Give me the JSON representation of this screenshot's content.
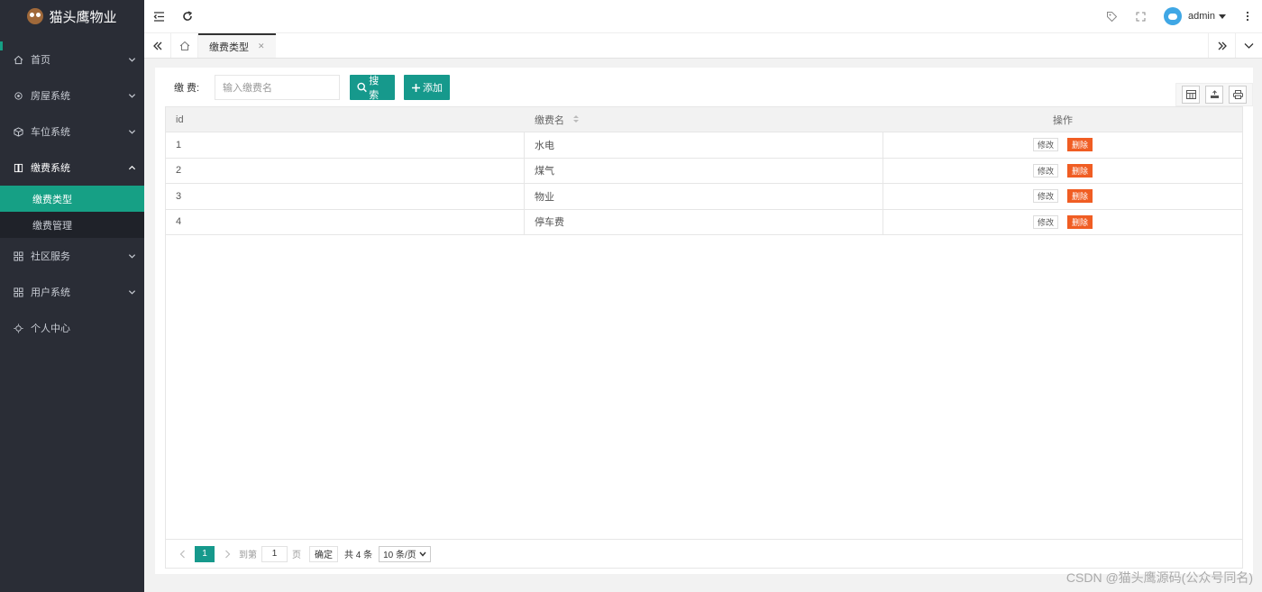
{
  "app": {
    "title": "猫头鹰物业"
  },
  "sidebar": {
    "items": [
      {
        "label": "首页",
        "icon": "home-icon",
        "has_children": true
      },
      {
        "label": "房屋系统",
        "icon": "settings-icon",
        "has_children": true
      },
      {
        "label": "车位系统",
        "icon": "cube-icon",
        "has_children": true
      },
      {
        "label": "缴费系统",
        "icon": "book-icon",
        "has_children": true,
        "open": true,
        "children": [
          {
            "label": "缴费类型",
            "active": true
          },
          {
            "label": "缴费管理"
          }
        ]
      },
      {
        "label": "社区服务",
        "icon": "apps-icon",
        "has_children": true
      },
      {
        "label": "用户系统",
        "icon": "apps-icon",
        "has_children": true
      },
      {
        "label": "个人中心",
        "icon": "gear-icon",
        "has_children": false
      }
    ]
  },
  "header": {
    "user": "admin"
  },
  "tabs": {
    "items": [
      {
        "label": "缴费类型"
      }
    ]
  },
  "toolbar": {
    "fee_label": "缴 费:",
    "search_placeholder": "输入缴费名",
    "search_label": "搜索",
    "add_label": "添加"
  },
  "table": {
    "columns": [
      "id",
      "缴费名",
      "操作"
    ],
    "edit_label": "修改",
    "delete_label": "删除",
    "rows": [
      {
        "id": "1",
        "name": "水电"
      },
      {
        "id": "2",
        "name": "煤气"
      },
      {
        "id": "3",
        "name": "物业"
      },
      {
        "id": "4",
        "name": "停车费"
      }
    ]
  },
  "pager": {
    "current": "1",
    "goto_label": "到第",
    "goto_value": "1",
    "page_unit": "页",
    "confirm_label": "确定",
    "total": "共 4 条",
    "page_size": "10 条/页"
  },
  "watermark": "CSDN @猫头鹰源码(公众号同名)",
  "colors": {
    "accent": "#16998c",
    "sidebar": "#2a2d36",
    "danger": "#f05d23"
  }
}
